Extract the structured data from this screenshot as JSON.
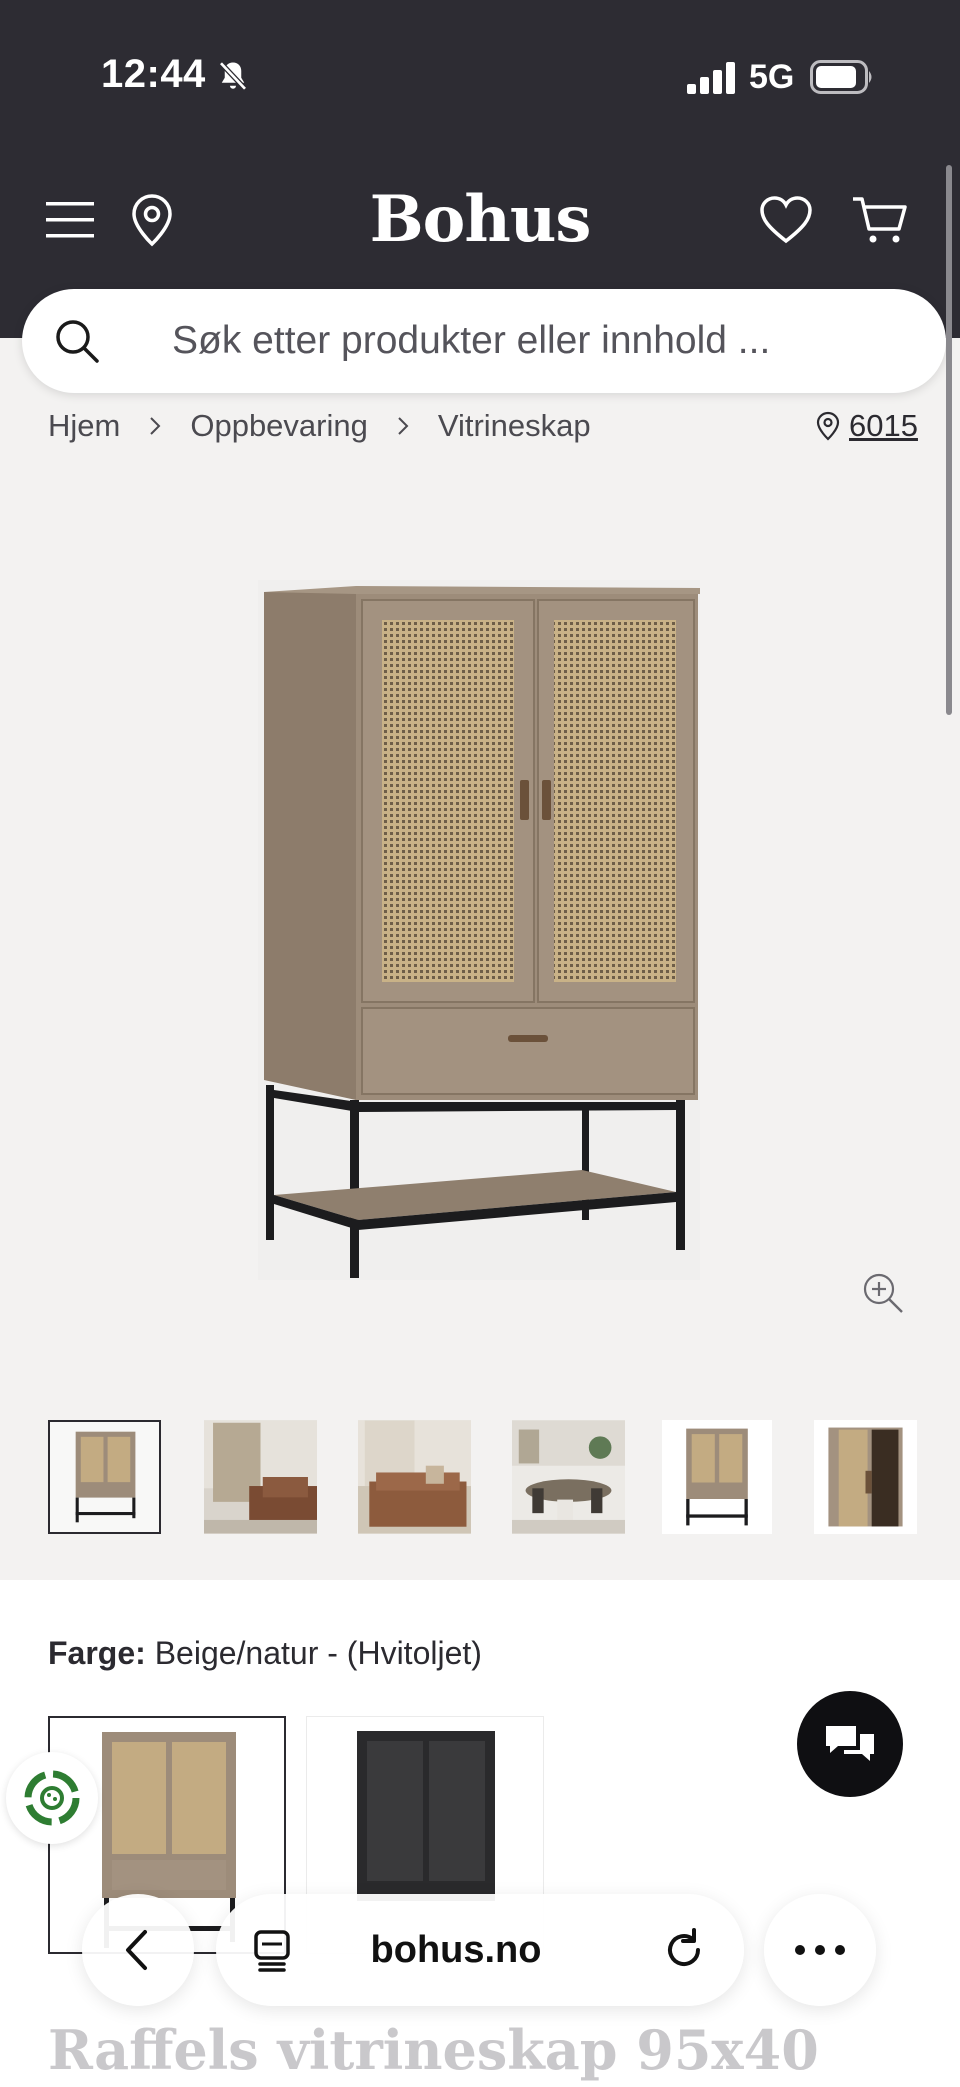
{
  "status": {
    "time": "12:44",
    "network": "5G"
  },
  "header": {
    "logo": "Bohus"
  },
  "search": {
    "placeholder": "Søk etter produkter eller innhold ..."
  },
  "breadcrumb": {
    "items": [
      "Hjem",
      "Oppbevaring",
      "Vitrineskap"
    ],
    "store": "6015"
  },
  "product": {
    "color_label": "Farge:",
    "color_value": "Beige/natur - (Hvitoljet)",
    "title": "Raffels vitrineskap 95x40"
  },
  "browser": {
    "domain": "bohus.no"
  },
  "colors": {
    "dark": "#2d2c33",
    "page_bg": "#f3f2f1",
    "wood": "#9a8a78",
    "rattan": "#c7ae84",
    "metal": "#1c1c1e"
  }
}
